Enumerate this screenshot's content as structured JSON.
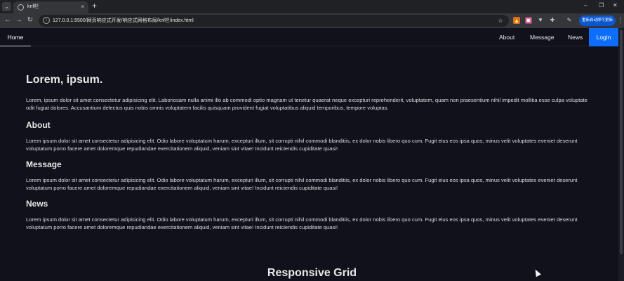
{
  "tab": {
    "menu_icon": "⌄",
    "title": "knf栏",
    "close": "×",
    "new_tab": "+"
  },
  "window_controls": {
    "minimize": "–",
    "maximize": "❐",
    "close": "✕"
  },
  "toolbar": {
    "back": "←",
    "forward": "→",
    "reload": "↻",
    "site_info": "i",
    "url": "127.0.0.1:5500/网页响应式开发/响应式网格布局/knf栏/index.html",
    "star": "☆",
    "update_label": "重新启动即可更新",
    "menu": "⋮"
  },
  "extensions": [
    "🔥",
    "▣",
    "▼",
    "✚",
    "✎"
  ],
  "nav": {
    "home": "Home",
    "links": [
      "About",
      "Message",
      "News"
    ],
    "login": "Login"
  },
  "main": {
    "title": "Lorem, ipsum.",
    "intro": "Lorem, ipsum dolor sit amet consectetur adipisicing elit. Laboriosam nulla animi illo ab commodi optio magnam ut tenetur quaerat neque excepturi reprehenderit, voluptatem, quam non praesentium nihil impedit mollitia esse culpa voluptate odit fugiat dolores. Accusantium delectus quis nobis omnis voluptatem facilis quisquam provident fugiat voluptatibus aliquid temporibus, tempore voluptas.",
    "sections": [
      {
        "heading": "About",
        "text": "Lorem ipsum dolor sit amet consectetur adipisicing elit. Odio labore voluptatum harum, excepturi illum, sit corrupti nihil commodi blanditiis, ex dolor nobis libero quo cum. Fugit eius eos ipsa quos, minus velit voluptates eveniet deserunt voluptatum porro facere amet doloremque repudiandae exercitationem aliquid, veniam sint vitae! Incidunt reiciendis cupiditate quasi!"
      },
      {
        "heading": "Message",
        "text": "Lorem ipsum dolor sit amet consectetur adipisicing elit. Odio labore voluptatum harum, excepturi illum, sit corrupti nihil commodi blanditiis, ex dolor nobis libero quo cum. Fugit eius eos ipsa quos, minus velit voluptates eveniet deserunt voluptatum porro facere amet doloremque repudiandae exercitationem aliquid, veniam sint vitae! Incidunt reiciendis cupiditate quasi!"
      },
      {
        "heading": "News",
        "text": "Lorem ipsum dolor sit amet consectetur adipisicing elit. Odio labore voluptatum harum, excepturi illum, sit corrupti nihil commodi blanditiis, ex dolor nobis libero quo cum. Fugit eius eos ipsa quos, minus velit voluptates eveniet deserunt voluptatum porro facere amet doloremque repudiandae exercitationem aliquid, veniam sint vitae! Incidunt reiciendis cupiditate quasi!"
      }
    ],
    "grid_title": "Responsive Grid"
  },
  "colors": {
    "page_bg": "#11111b",
    "accent": "#0d6efd",
    "toolbar_bg": "#35363a",
    "tabstrip_bg": "#202124"
  }
}
